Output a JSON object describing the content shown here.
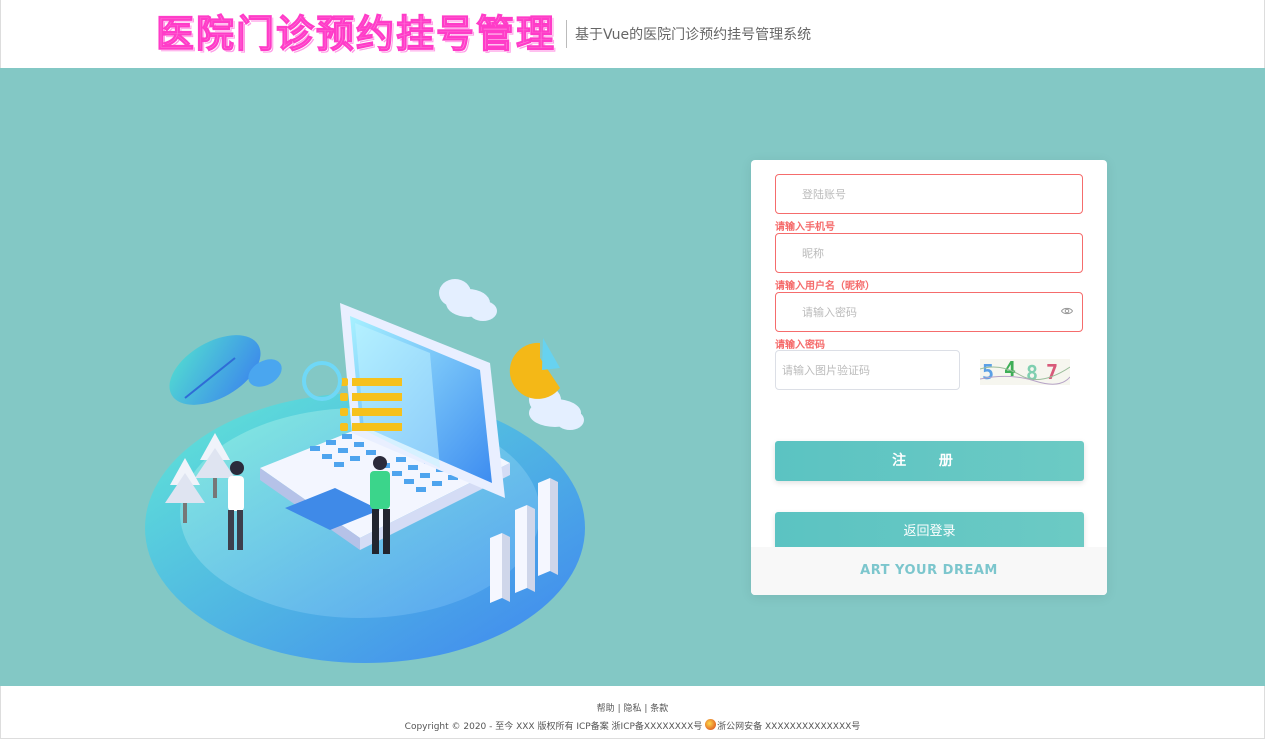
{
  "header": {
    "title": "医院门诊预约挂号管理",
    "subtitle": "基于Vue的医院门诊预约挂号管理系统"
  },
  "form": {
    "account_placeholder": "登陆账号",
    "account_error": "请输入手机号",
    "nickname_placeholder": "昵称",
    "nickname_error": "请输入用户名（昵称）",
    "password_placeholder": "请输入密码",
    "password_error": "请输入密码",
    "captcha_placeholder": "请输入图片验证码",
    "captcha_chars": [
      "5",
      "4",
      "8",
      "7"
    ],
    "register_label": "注 册",
    "back_label": "返回登录",
    "slogan": "ART YOUR DREAM"
  },
  "footer": {
    "link_help": "帮助",
    "link_privacy": "隐私",
    "link_terms": "条款",
    "sep": "|",
    "copyright": "Copyright © 2020 - 至今 XXX 版权所有 ICP备案 浙ICP备XXXXXXXX号",
    "police": "浙公网安备 XXXXXXXXXXXXXX号"
  },
  "colors": {
    "accent": "#83c8c5",
    "button": "#5bc3c2",
    "error": "#f56c6c",
    "brand": "#ff77d9"
  }
}
